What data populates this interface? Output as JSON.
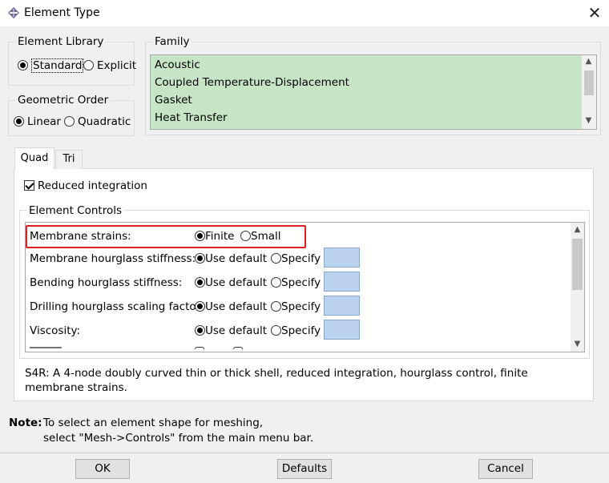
{
  "window": {
    "title": "Element Type",
    "close_glyph": "✕"
  },
  "element_library": {
    "label": "Element Library",
    "options": [
      {
        "label": "Standard",
        "selected": true
      },
      {
        "label": "Explicit",
        "selected": false
      }
    ]
  },
  "geometric_order": {
    "label": "Geometric Order",
    "options": [
      {
        "label": "Linear",
        "selected": true
      },
      {
        "label": "Quadratic",
        "selected": false
      }
    ]
  },
  "family": {
    "label": "Family",
    "items": [
      "Acoustic",
      "Coupled Temperature-Displacement",
      "Gasket",
      "Heat Transfer"
    ]
  },
  "tabs": [
    {
      "label": "Quad",
      "active": true
    },
    {
      "label": "Tri",
      "active": false
    }
  ],
  "reduced_integration": {
    "label": "Reduced integration",
    "checked": true
  },
  "element_controls": {
    "label": "Element Controls",
    "rows": [
      {
        "label": "Membrane strains:",
        "opt1": "Finite",
        "opt2": "Small"
      },
      {
        "label": "Membrane hourglass stiffness:",
        "opt1": "Use default",
        "opt2": "Specify"
      },
      {
        "label": "Bending hourglass stiffness:",
        "opt1": "Use default",
        "opt2": "Specify"
      },
      {
        "label": "Drilling hourglass scaling factor:",
        "opt1": "Use default",
        "opt2": "Specify"
      },
      {
        "label": "Viscosity:",
        "opt1": "Use default",
        "opt2": "Specify"
      }
    ]
  },
  "description": "S4R:  A 4-node doubly curved thin or thick shell, reduced integration, hourglass control, finite membrane strains.",
  "note": {
    "label": "Note:",
    "line1": "To select an element shape for meshing,",
    "line2": "select \"Mesh->Controls\" from the main menu bar."
  },
  "buttons": {
    "ok": "OK",
    "defaults": "Defaults",
    "cancel": "Cancel"
  },
  "colors": {
    "family_bg": "#c6e5c6",
    "specify_bg": "#bcd3ef",
    "highlight": "#e02020"
  }
}
